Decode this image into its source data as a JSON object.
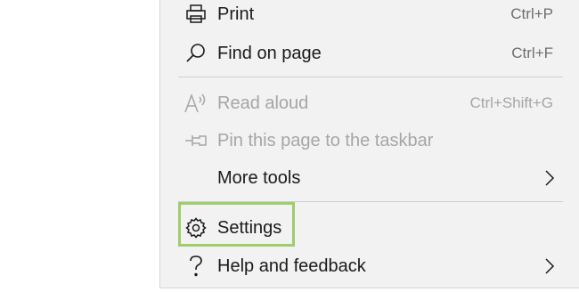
{
  "menu": {
    "items": [
      {
        "label": "Print",
        "shortcut": "Ctrl+P",
        "icon": "printer-icon",
        "enabled": true
      },
      {
        "label": "Find on page",
        "shortcut": "Ctrl+F",
        "icon": "magnifier-icon",
        "enabled": true
      },
      {
        "label": "Read aloud",
        "shortcut": "Ctrl+Shift+G",
        "icon": "read-aloud-icon",
        "enabled": false
      },
      {
        "label": "Pin this page to the taskbar",
        "shortcut": "",
        "icon": "pin-icon",
        "enabled": false
      },
      {
        "label": "More tools",
        "shortcut": "",
        "icon": "chevron-right-icon",
        "enabled": true
      },
      {
        "label": "Settings",
        "shortcut": "",
        "icon": "gear-icon",
        "enabled": true,
        "highlighted": true
      },
      {
        "label": "Help and feedback",
        "shortcut": "",
        "icon": "question-icon",
        "enabled": true
      }
    ],
    "colors": {
      "background": "#f2f2f2",
      "text": "#1a1a1a",
      "disabled_text": "#a6a6a6",
      "highlight": "#9dce6a"
    }
  }
}
